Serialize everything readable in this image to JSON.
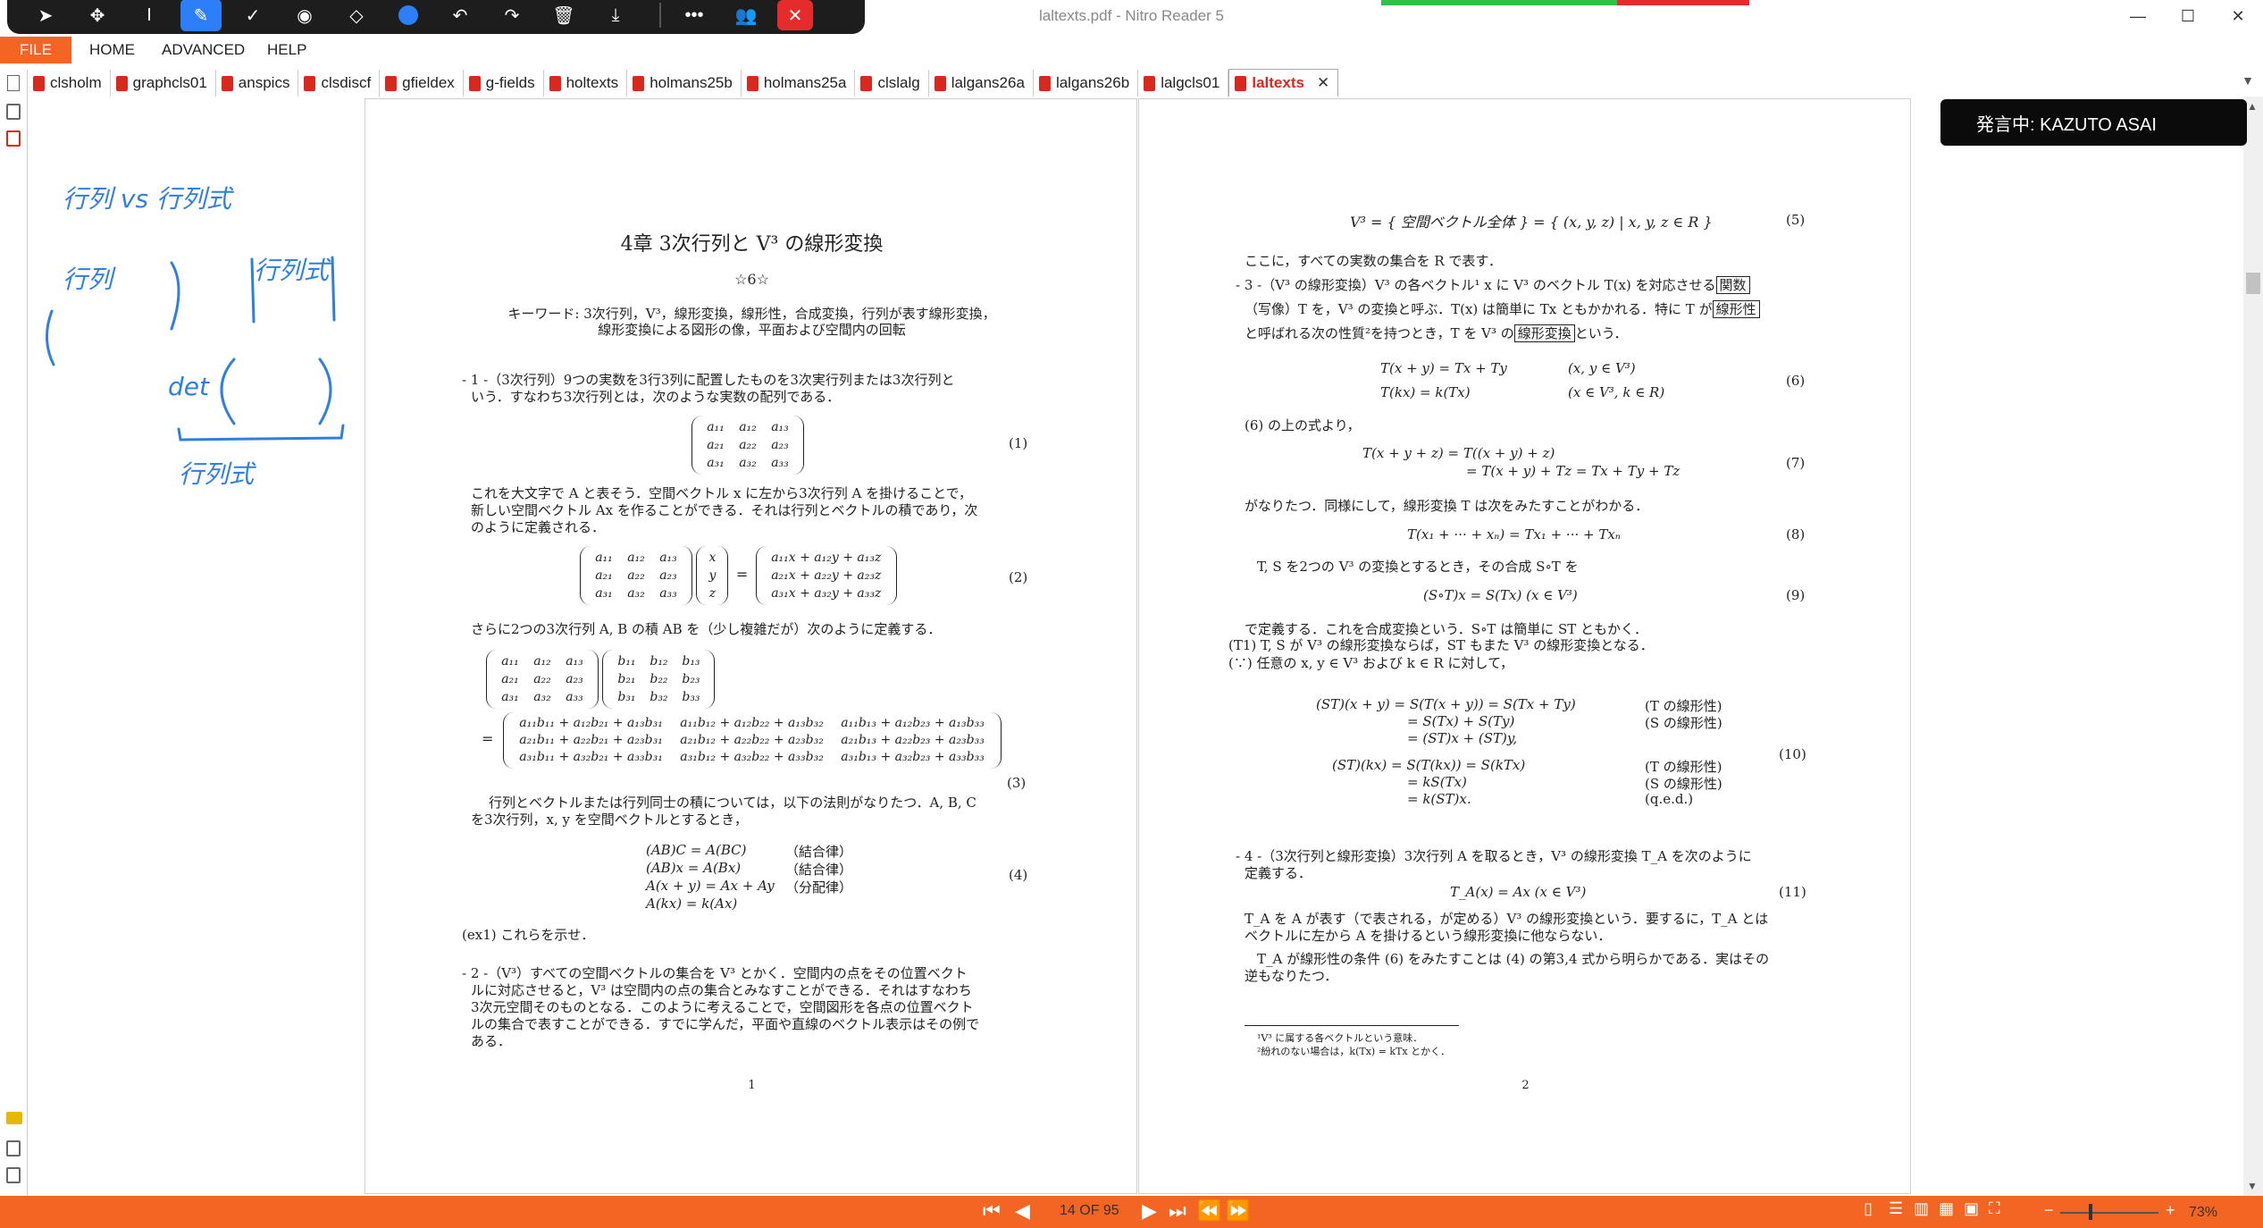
{
  "window": {
    "title": "laltexts.pdf - Nitro Reader 5",
    "minimize": "—",
    "maximize": "☐",
    "close": "✕"
  },
  "pen_toolbar": {
    "icons": [
      "pointer-icon",
      "move-icon",
      "text-cursor-icon",
      "pen-icon",
      "check-icon",
      "highlighter-icon",
      "eraser-icon",
      "color-dot-icon",
      "undo-icon",
      "redo-icon",
      "delete-icon",
      "download-icon",
      "more-icon",
      "people-icon",
      "close-icon"
    ]
  },
  "ribbon": {
    "file": "FILE",
    "tabs": [
      "HOME",
      "ADVANCED",
      "HELP"
    ]
  },
  "doc_tabs": [
    "clsholm",
    "graphcls01",
    "anspics",
    "clsdiscf",
    "gfieldex",
    "g-fields",
    "holtexts",
    "holmans25b",
    "holmans25a",
    "clslalg",
    "lalgans26a",
    "lalgans26b",
    "lalgcls01",
    "laltexts"
  ],
  "active_tab": "laltexts",
  "speaker": {
    "label": "発言中: KAZUTO ASAI"
  },
  "ink": {
    "line1": "行列 vs 行列式",
    "left_label": "行列",
    "right_label": "行列式",
    "det": "det",
    "bottom": "行列式"
  },
  "page1": {
    "chapter": "4章  3次行列と V³ の線形変換",
    "star": "☆6☆",
    "keywords_1": "キーワード: 3次行列，V³，線形変換，線形性，合成変換，行列が表す線形変換，",
    "keywords_2": "線形変換による図形の像，平面および空間内の回転",
    "s1_a": "- 1 -（3次行列）9つの実数を3行3列に配置したものを3次実行列または3次行列と",
    "s1_b": "いう．すなわち3次行列とは，次のような実数の配列である．",
    "eq1": "(1)",
    "p1_a": "これを大文字で A と表そう．空間ベクトル x に左から3次行列 A を掛けることで，",
    "p1_b": "新しい空間ベクトル Ax を作ることができる．それは行列とベクトルの積であり，次",
    "p1_c": "のように定義される．",
    "eq2": "(2)",
    "p2": "さらに2つの3次行列 A, B の積 AB を（少し複雑だが）次のように定義する．",
    "eq3": "(3)",
    "p3_a": "行列とベクトルまたは行列同士の積については，以下の法則がなりたつ．A, B, C",
    "p3_b": "を3次行列，x, y を空間ベクトルとするとき，",
    "law1": "(AB)C = A(BC)",
    "law1n": "（結合律）",
    "law2": "(AB)x = A(Bx)",
    "law2n": "（結合律）",
    "law3": "A(x + y) = Ax + Ay",
    "law3n": "（分配律）",
    "law4": "A(kx) = k(Ax)",
    "eq4": "(4)",
    "ex1": "(ex1)  これらを示せ．",
    "s2_a": "- 2 -（V³）すべての空間ベクトルの集合を V³ とかく．空間内の点をその位置ベクト",
    "s2_b": "ルに対応させると，V³ は空間内の点の集合とみなすことができる．それはすなわち",
    "s2_c": "3次元空間そのものとなる．このように考えることで，空間図形を各点の位置ベクト",
    "s2_d": "ルの集合で表すことができる．すでに学んだ，平面や直線のベクトル表示はその例で",
    "s2_e": "ある．",
    "page_no": "1"
  },
  "page2": {
    "l1": "V³ = { 空間ベクトル全体 } = { (x, y, z) | x, y, z ∈ R }",
    "eq5": "(5)",
    "l2": "ここに，すべての実数の集合を R で表す．",
    "s3_a": "- 3 -（V³ の線形変換）V³ の各ベクトル¹ x に V³ のベクトル T(x) を対応させる",
    "s3_box1": "関数",
    "s3_b": "（写像）T を，V³ の変換と呼ぶ．T(x) は簡単に Tx ともかかれる．特に T が",
    "s3_box2": "線形性",
    "s3_c": "と呼ばれる次の性質²を持つとき，T を V³ の",
    "s3_box3": "線形変換",
    "s3_d": "という．",
    "e6a": "T(x + y) = Tx + Ty",
    "e6a_c": "(x, y ∈ V³)",
    "e6b": "T(kx) = k(Tx)",
    "e6b_c": "(x ∈ V³, k ∈ R)",
    "eq6": "(6)",
    "l3": "(6) の上の式より，",
    "e7a": "T(x + y + z) =  T((x + y) + z)",
    "e7b": "=  T(x + y) + Tz = Tx + Ty + Tz",
    "eq7": "(7)",
    "l4": "がなりたつ．同様にして，線形変換 T は次をみたすことがわかる．",
    "e8": "T(x₁ + ··· + xₙ) = Tx₁ + ··· + Txₙ",
    "eq8": "(8)",
    "l5": "T, S を2つの V³ の変換とするとき，その合成 S∘T を",
    "e9": "(S∘T)x = S(Tx)        (x ∈ V³)",
    "eq9": "(9)",
    "l6": "で定義する．これを合成変換という．S∘T は簡単に ST ともかく．",
    "l7": "(T1)  T, S が V³ の線形変換ならば，ST もまた V³ の線形変換となる．",
    "l8": "(∵) 任意の x, y ∈ V³ および k ∈ R に対して，",
    "e10a": "(ST)(x + y)   = S(T(x + y)) = S(Tx + Ty)",
    "e10a_n": "(T の線形性)",
    "e10b": "= S(Tx) + S(Ty)",
    "e10b_n": "(S の線形性)",
    "e10c": "= (ST)x + (ST)y,",
    "e10d": "(ST)(kx)   = S(T(kx)) = S(kTx)",
    "e10d_n": "(T の線形性)",
    "e10e": "= kS(Tx)",
    "e10e_n": "(S の線形性)",
    "e10f": "= k(ST)x.",
    "e10f_n": "(q.e.d.)",
    "eq10": "(10)",
    "s4_a": "- 4 -（3次行列と線形変換）3次行列 A を取るとき，V³ の線形変換 T_A を次のように",
    "s4_b": "定義する．",
    "e11": "T_A(x) = Ax    (x ∈ V³)",
    "eq11": "(11)",
    "l9": "T_A を A が表す（で表される，が定める）V³ の線形変換という．要するに，T_A とは",
    "l10": "ベクトルに左から A を掛けるという線形変換に他ならない．",
    "l11": "T_A が線形性の条件 (6) をみたすことは (4) の第3,4 式から明らかである．実はその",
    "l12": "逆もなりたつ．",
    "fn1": "¹V³ に属する各ベクトルという意味．",
    "fn2": "²紛れのない場合は，k(Tx) = kTx とかく．",
    "page_no": "2"
  },
  "status": {
    "page_indicator": "14 OF 95",
    "zoom": "73%",
    "zoom_minus": "−",
    "zoom_plus": "+"
  },
  "colors": {
    "accent": "#f26522",
    "ink_blue": "#2f7fe0",
    "pdf_red": "#d9281e",
    "toolbar_bg": "#1d1d1d",
    "pen_selected": "#2d7ff9"
  }
}
